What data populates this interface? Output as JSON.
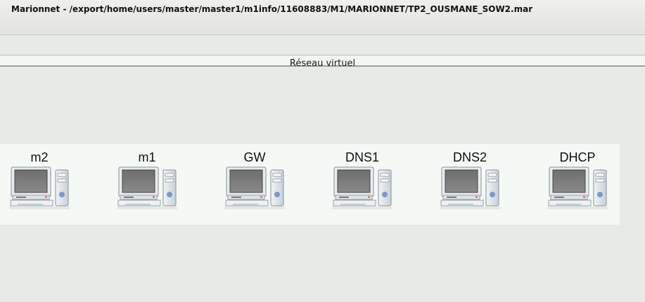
{
  "window": {
    "title": "Marionnet - /export/home/users/master/master1/m1info/11608883/M1/MARIONNET/TP2_OUSMANE_SOW2.mar"
  },
  "tabs": [
    {
      "label": "Réseau virtuel"
    }
  ],
  "network": {
    "nodes": [
      {
        "label": "m2",
        "icon": "computer-icon"
      },
      {
        "label": "m1",
        "icon": "computer-icon"
      },
      {
        "label": "GW",
        "icon": "computer-icon"
      },
      {
        "label": "DNS1",
        "icon": "computer-icon"
      },
      {
        "label": "DNS2",
        "icon": "computer-icon"
      },
      {
        "label": "DHCP",
        "icon": "computer-icon"
      }
    ]
  }
}
